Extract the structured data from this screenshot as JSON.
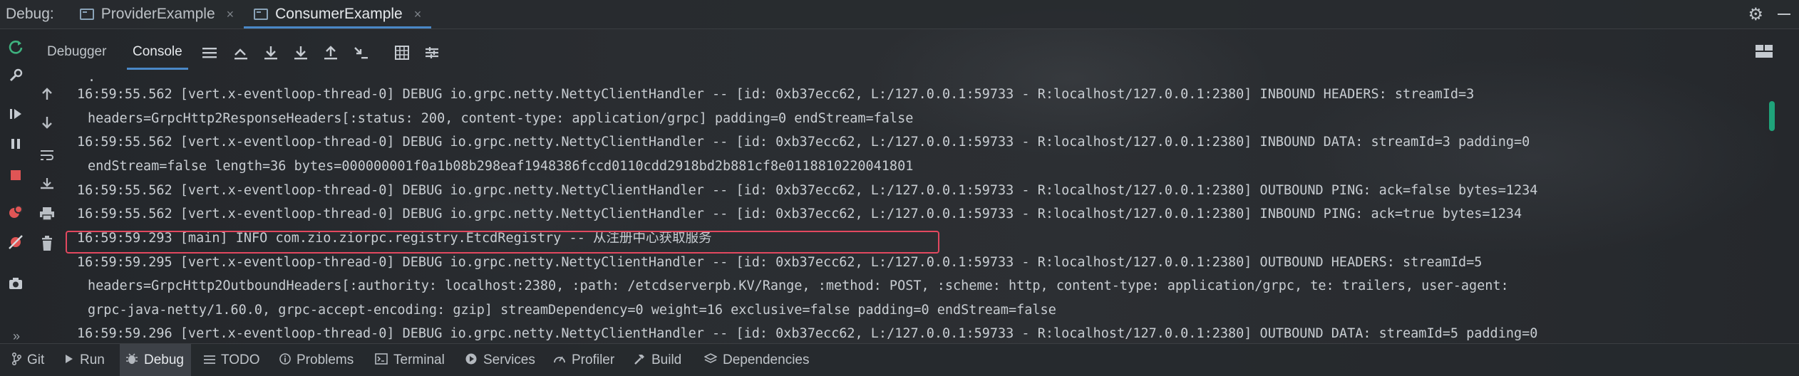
{
  "titlebar": {
    "label": "Debug:",
    "tabs": [
      {
        "label": "ProviderExample",
        "active": false
      },
      {
        "label": "ConsumerExample",
        "active": true
      }
    ],
    "close_glyph": "×"
  },
  "toolbar": {
    "tabs": [
      {
        "label": "Debugger",
        "active": false
      },
      {
        "label": "Console",
        "active": true
      }
    ]
  },
  "console": {
    "lines": [
      {
        "text": ".",
        "cont": true
      },
      {
        "text": "16:59:55.562 [vert.x-eventloop-thread-0] DEBUG io.grpc.netty.NettyClientHandler -- [id: 0xb37ecc62, L:/127.0.0.1:59733 - R:localhost/127.0.0.1:2380] INBOUND HEADERS: streamId=3",
        "cont": false
      },
      {
        "text": "headers=GrpcHttp2ResponseHeaders[:status: 200, content-type: application/grpc] padding=0 endStream=false",
        "cont": true
      },
      {
        "text": "16:59:55.562 [vert.x-eventloop-thread-0] DEBUG io.grpc.netty.NettyClientHandler -- [id: 0xb37ecc62, L:/127.0.0.1:59733 - R:localhost/127.0.0.1:2380] INBOUND DATA: streamId=3 padding=0",
        "cont": false
      },
      {
        "text": "endStream=false length=36 bytes=000000001f0a1b08b298eaf1948386fccd0110cdd2918bd2b881cf8e0118810220041801",
        "cont": true
      },
      {
        "text": "16:59:55.562 [vert.x-eventloop-thread-0] DEBUG io.grpc.netty.NettyClientHandler -- [id: 0xb37ecc62, L:/127.0.0.1:59733 - R:localhost/127.0.0.1:2380] OUTBOUND PING: ack=false bytes=1234",
        "cont": false
      },
      {
        "text": "16:59:55.562 [vert.x-eventloop-thread-0] DEBUG io.grpc.netty.NettyClientHandler -- [id: 0xb37ecc62, L:/127.0.0.1:59733 - R:localhost/127.0.0.1:2380] INBOUND PING: ack=true bytes=1234",
        "cont": false
      },
      {
        "text": "16:59:59.293 [main] INFO com.zio.ziorpc.registry.EtcdRegistry -- 从注册中心获取服务",
        "cont": false,
        "highlighted": true
      },
      {
        "text": "16:59:59.295 [vert.x-eventloop-thread-0] DEBUG io.grpc.netty.NettyClientHandler -- [id: 0xb37ecc62, L:/127.0.0.1:59733 - R:localhost/127.0.0.1:2380] OUTBOUND HEADERS: streamId=5",
        "cont": false
      },
      {
        "text": "headers=GrpcHttp2OutboundHeaders[:authority: localhost:2380, :path: /etcdserverpb.KV/Range, :method: POST, :scheme: http, content-type: application/grpc, te: trailers, user-agent:",
        "cont": true
      },
      {
        "text": "grpc-java-netty/1.60.0, grpc-accept-encoding: gzip] streamDependency=0 weight=16 exclusive=false padding=0 endStream=false",
        "cont": true
      },
      {
        "text": "16:59:59.296 [vert.x-eventloop-thread-0] DEBUG io.grpc.netty.NettyClientHandler -- [id: 0xb37ecc62, L:/127.0.0.1:59733 - R:localhost/127.0.0.1:2380] OUTBOUND DATA: streamId=5 padding=0",
        "cont": false
      }
    ]
  },
  "bottom_bar": {
    "expand_glyph": "»",
    "items": [
      {
        "label": "Git",
        "icon": "git-branch-icon",
        "active": false
      },
      {
        "label": "Run",
        "icon": "play-icon",
        "active": false
      },
      {
        "label": "Debug",
        "icon": "bug-icon",
        "active": true
      },
      {
        "label": "TODO",
        "icon": "list-icon",
        "active": false
      },
      {
        "label": "Problems",
        "icon": "info-icon",
        "active": false
      },
      {
        "label": "Terminal",
        "icon": "terminal-icon",
        "active": false
      },
      {
        "label": "Services",
        "icon": "services-icon",
        "active": false
      },
      {
        "label": "Profiler",
        "icon": "profiler-icon",
        "active": false
      },
      {
        "label": "Build",
        "icon": "hammer-icon",
        "active": false
      },
      {
        "label": "Dependencies",
        "icon": "layers-icon",
        "active": false
      }
    ]
  },
  "colors": {
    "accent": "#4a88c7",
    "highlight_border": "#e2485f",
    "stop_red": "#e05555",
    "rerun_green": "#3fb27f",
    "scroll_green": "#1fa37a"
  }
}
